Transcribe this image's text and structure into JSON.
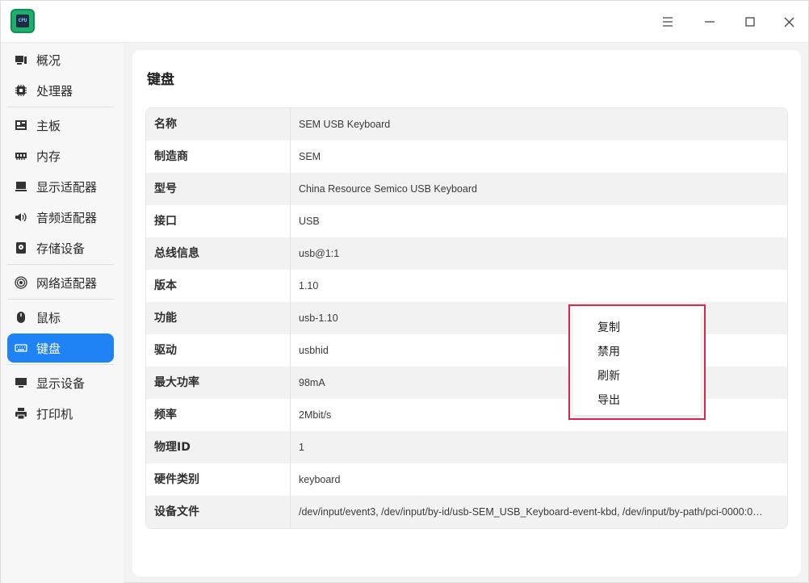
{
  "app": {
    "icon": "cpu-app-icon",
    "icon_text": "CPU"
  },
  "titlebar": {
    "menu_icon": "hamburger-menu-icon",
    "minimize_icon": "minimize-icon",
    "maximize_icon": "maximize-icon",
    "close_icon": "close-icon"
  },
  "sidebar": {
    "items": [
      {
        "label": "概况",
        "icon": "overview-icon"
      },
      {
        "label": "处理器",
        "icon": "cpu-icon"
      },
      {
        "label": "主板",
        "icon": "motherboard-icon"
      },
      {
        "label": "内存",
        "icon": "memory-icon"
      },
      {
        "label": "显示适配器",
        "icon": "display-adapter-icon"
      },
      {
        "label": "音频适配器",
        "icon": "audio-adapter-icon"
      },
      {
        "label": "存储设备",
        "icon": "storage-icon"
      },
      {
        "label": "网络适配器",
        "icon": "network-adapter-icon"
      },
      {
        "label": "鼠标",
        "icon": "mouse-icon"
      },
      {
        "label": "键盘",
        "icon": "keyboard-icon",
        "active": true
      },
      {
        "label": "显示设备",
        "icon": "monitor-icon"
      },
      {
        "label": "打印机",
        "icon": "printer-icon"
      }
    ],
    "accent_color": "#1f83f5"
  },
  "main": {
    "title": "键盘",
    "rows": [
      {
        "key": "名称",
        "value": "SEM USB Keyboard"
      },
      {
        "key": "制造商",
        "value": "SEM"
      },
      {
        "key": "型号",
        "value": "China Resource Semico USB Keyboard"
      },
      {
        "key": "接口",
        "value": "USB"
      },
      {
        "key": "总线信息",
        "value": "usb@1:1"
      },
      {
        "key": "版本",
        "value": "1.10"
      },
      {
        "key": "功能",
        "value": "usb-1.10"
      },
      {
        "key": "驱动",
        "value": "usbhid"
      },
      {
        "key": "最大功率",
        "value": "98mA"
      },
      {
        "key": "频率",
        "value": "2Mbit/s"
      },
      {
        "key": "物理ID",
        "value": "1"
      },
      {
        "key": "硬件类别",
        "value": "keyboard"
      },
      {
        "key": "设备文件",
        "value": "/dev/input/event3, /dev/input/by-id/usb-SEM_USB_Keyboard-event-kbd, /dev/input/by-path/pci-0000:0…"
      }
    ]
  },
  "context_menu": {
    "items": [
      "复制",
      "禁用",
      "刷新",
      "导出"
    ],
    "highlight_color": "#e0244c"
  }
}
